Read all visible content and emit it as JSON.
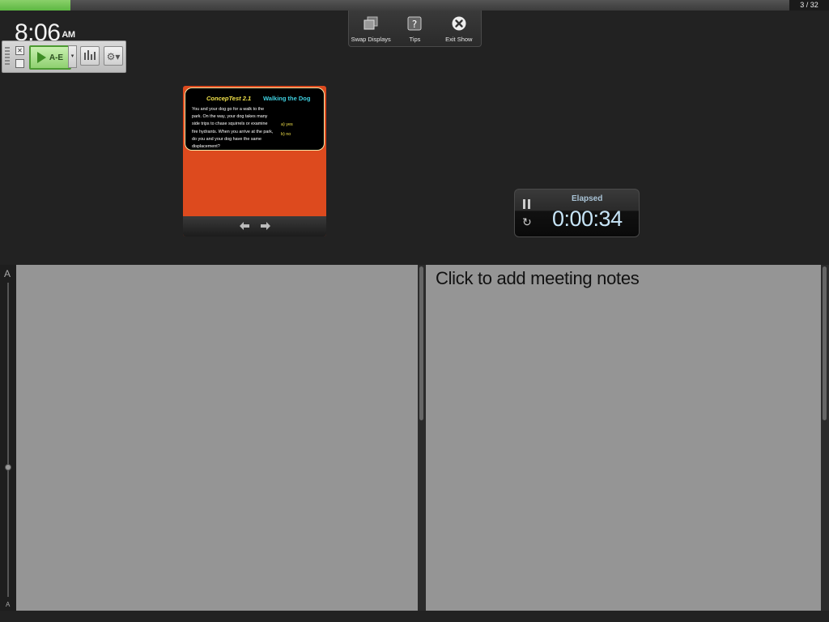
{
  "progress": {
    "fraction": 0.089,
    "counter": "3 / 32",
    "fill_color": "#5db842"
  },
  "clock": {
    "time": "8:06",
    "ampm": "AM"
  },
  "toolbar": {
    "swap_label": "Swap Displays",
    "tips_label": "Tips",
    "exit_label": "Exit Show",
    "swap_icon": "displays-icon",
    "tips_icon": "question-icon",
    "exit_icon": "close-circle-icon"
  },
  "plugin": {
    "play_label": "A-E",
    "close_glyph": "✕",
    "dropdown_glyph": "▾",
    "gear_glyph": "⚙▾"
  },
  "slide": {
    "title_left": "ConcepTest 2.1",
    "title_right": "Walking the Dog",
    "body": "You and your dog go for a walk to the park. On the way, your dog takes many side trips to chase squirrels or examine fire hydrants. When you arrive at the park, do you and your dog have the same displacement?",
    "option_a": "a)  yes",
    "option_b": "b)  no",
    "background_color": "#dd4a1e",
    "prev_glyph": "🡄",
    "next_glyph": "🡆"
  },
  "timer": {
    "label": "Elapsed",
    "value": "0:00:34",
    "reset_glyph": "↻"
  },
  "zoom": {
    "large_label": "A",
    "small_label": "A"
  },
  "notes": {
    "placeholder": "Click to add meeting notes"
  }
}
